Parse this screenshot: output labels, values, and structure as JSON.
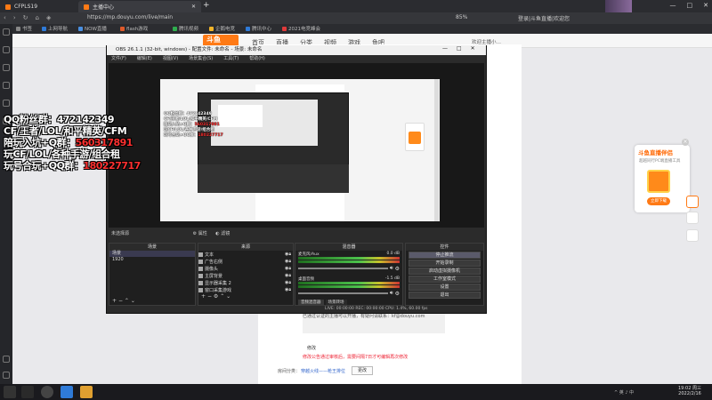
{
  "browser": {
    "tab1_label": "CFPLS19",
    "tab2_label": "主播中心",
    "new_tab": "+",
    "url": "https://mp.douyu.com/live/main",
    "zoom": "85%",
    "user_info": "登录|斗鱼直播|欢迎您",
    "window_controls": [
      "—",
      "□",
      "✕"
    ],
    "bookmarks": [
      {
        "label": "书签",
        "color": "#888888"
      },
      {
        "label": "上网导航",
        "color": "#2f7bd8"
      },
      {
        "label": "NOW直播",
        "color": "#4a90e2"
      },
      {
        "label": "flash游戏",
        "color": "#e05a2a"
      },
      {
        "label": "腾讯视频",
        "color": "#2fae4e"
      },
      {
        "label": "企鹅电竞",
        "color": "#f0b429"
      },
      {
        "label": "腾讯中心",
        "color": "#2f7bd8"
      },
      {
        "label": "2021电竞峰会",
        "color": "#e03a3a"
      }
    ]
  },
  "site": {
    "logo": "斗鱼",
    "nav": [
      "首页",
      "直播",
      "分类",
      "视频",
      "游戏",
      "鱼吧"
    ],
    "user": "欢迎主播小…",
    "notice_1": "已通过认证的主播可以开播，有疑问请联系：kf@douyu.com",
    "notice_2": "修改",
    "notice_3": "修改公告通过审核后，需要间隔7日才可编辑再次修改",
    "notice_4": "房间分类：",
    "notice_link": "穿越火线——枪王排位",
    "notice_btn": "更改"
  },
  "promo": {
    "title": "斗鱼直播伴侣",
    "subtitle": "超越同行PC端直播工具",
    "button": "立即下载",
    "close": "×"
  },
  "overlay": {
    "line1": "QQ粉丝群：472142349",
    "line2": "CF/王者/LOL/和平精英/CFM",
    "line3_prefix": "陪玩入坑+Q群：",
    "line3_num": "560317891",
    "line4": "玩CF/LOL/各种手游/组合租",
    "line5_prefix": "玩号合玩+QQ群：",
    "line5_num": "180227717"
  },
  "obs": {
    "title": "OBS 26.1.1 (32-bit, windows) - 配置文件: 未命名 - 场景: 未命名",
    "menu": [
      "文件(F)",
      "编辑(E)",
      "视图(V)",
      "场景集合(S)",
      "工具(T)",
      "帮助(H)"
    ],
    "source_bar": "未选择源",
    "source_bar_btns": [
      "属性",
      "滤镜"
    ],
    "scenes_header": "场景",
    "scenes": [
      "场景",
      "1920"
    ],
    "sources_header": "来源",
    "sources": [
      "文本",
      "广告右侧",
      "摄像头",
      "主屏背景",
      "显示器采集 2",
      "窗口采集游戏"
    ],
    "mixer_header": "混音器",
    "mixer_channels": [
      {
        "name": "麦克风/Aux",
        "db": "0.0 dB"
      },
      {
        "name": "桌面音频",
        "db": "-1.5 dB"
      }
    ],
    "mixer_tabs": [
      "音频混音器",
      "场景转场"
    ],
    "controls_header": "控件",
    "controls": [
      "停止推流",
      "开始录制",
      "启动虚拟摄像机",
      "工作室模式",
      "设置",
      "退出"
    ],
    "status": "LIVE: 00:00:00   REC: 00:00:00   CPU: 1.4%, 60.00 fps"
  },
  "taskbar": {
    "time": "19:02 周三",
    "date": "2022/2/16",
    "tray": "^ 英 ♪ 中"
  }
}
